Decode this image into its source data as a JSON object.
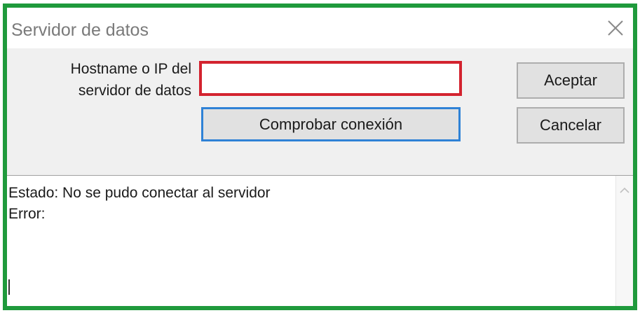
{
  "window": {
    "title": "Servidor de datos"
  },
  "form": {
    "host_label_line1": "Hostname o IP del",
    "host_label_line2": "servidor de datos",
    "host_value": "",
    "check_button_label": "Comprobar conexión"
  },
  "buttons": {
    "accept_label": "Aceptar",
    "cancel_label": "Cancelar"
  },
  "output": {
    "status_line": "Estado: No se pudo conectar al servidor",
    "error_line": "Error:"
  },
  "icons": {
    "close": "close-icon",
    "scroll_up": "chevron-up-icon"
  },
  "colors": {
    "window_border": "#1f9a3c",
    "input_border_error": "#d3232f",
    "focus_border": "#2f82d6"
  }
}
